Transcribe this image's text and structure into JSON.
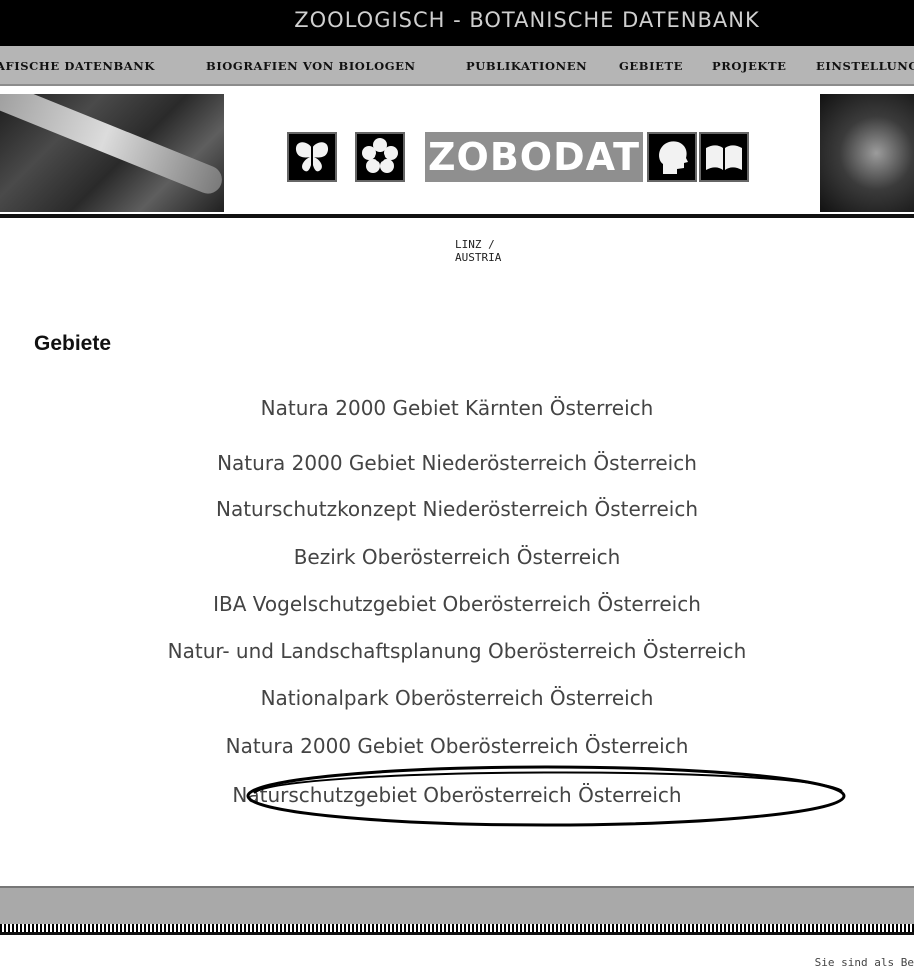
{
  "header": {
    "title": "ZOOLOGISCH - BOTANISCHE DATENBANK"
  },
  "nav": {
    "items": [
      {
        "label": "AFISCHE DATENBANK"
      },
      {
        "label": "BIOGRAFIEN VON BIOLOGEN"
      },
      {
        "label": "PUBLIKATIONEN"
      },
      {
        "label": "GEBIETE"
      },
      {
        "label": "PROJEKTE"
      },
      {
        "label": "EINSTELLUNG"
      }
    ]
  },
  "logo": {
    "wordmark": "ZOBODAT",
    "subtitle": "LINZ / AUSTRIA"
  },
  "main": {
    "title": "Gebiete",
    "areas": [
      {
        "label": "Natura 2000 Gebiet Kärnten Österreich"
      },
      {
        "label": "Natura 2000 Gebiet Niederösterreich Österreich"
      },
      {
        "label": "Naturschutzkonzept Niederösterreich Österreich"
      },
      {
        "label": "Bezirk Oberösterreich Österreich"
      },
      {
        "label": "IBA Vogelschutzgebiet Oberösterreich Österreich"
      },
      {
        "label": "Natur- und Landschaftsplanung Oberösterreich Österreich"
      },
      {
        "label": "Nationalpark Oberösterreich Österreich"
      },
      {
        "label": "Natura 2000 Gebiet Oberösterreich Österreich"
      },
      {
        "label": "Naturschutzgebiet Oberösterreich Österreich",
        "highlighted": true
      }
    ]
  },
  "footer": {
    "status_text": "Sie sind als Be"
  },
  "colors": {
    "top_bar": "#000000",
    "nav_bar": "#b5b5b5",
    "link_text": "#444444",
    "logo_word_bg": "#8f8f8f"
  },
  "icons": [
    "butterfly-icon",
    "flower-icon",
    "head-icon",
    "book-icon"
  ]
}
